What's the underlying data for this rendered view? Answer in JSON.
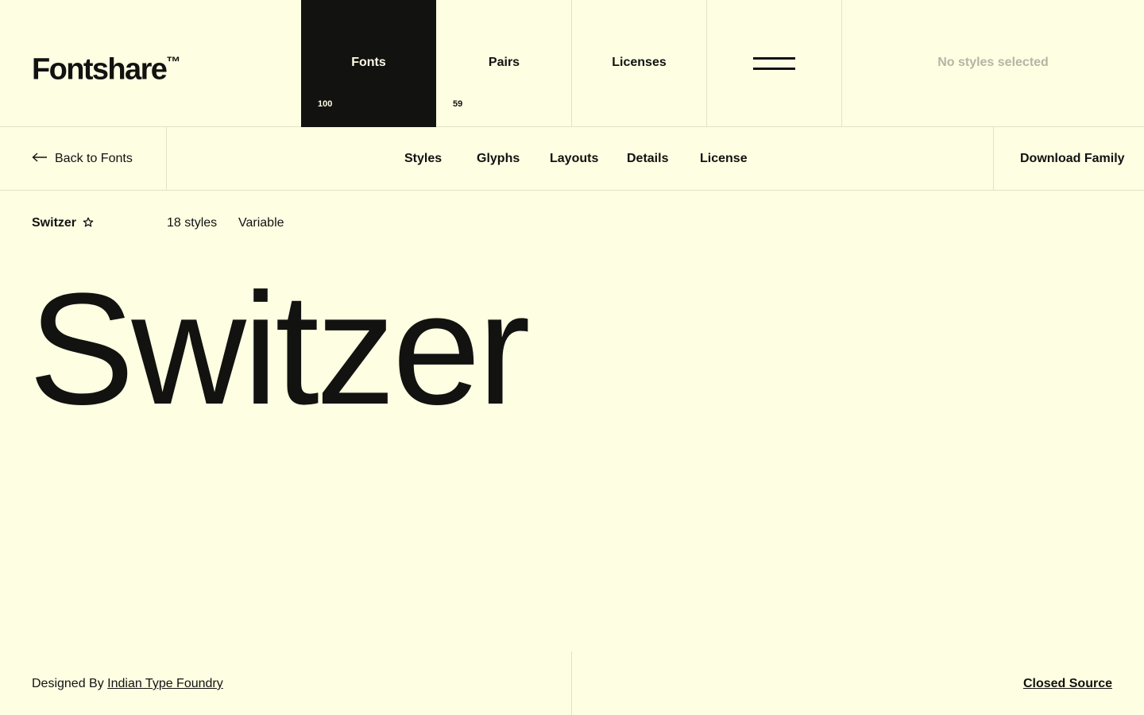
{
  "header": {
    "logo": "Fontshare",
    "logo_mark": "™",
    "nav": [
      {
        "label": "Fonts",
        "count": "100"
      },
      {
        "label": "Pairs",
        "count": "59"
      },
      {
        "label": "Licenses"
      }
    ],
    "menu_icon": "hamburger-icon",
    "styles_status": "No styles selected"
  },
  "subnav": {
    "back_label": "Back to Fonts",
    "back_icon": "arrow-left-icon",
    "tabs": [
      "Styles",
      "Glyphs",
      "Layouts",
      "Details",
      "License"
    ],
    "download_label": "Download Family"
  },
  "font": {
    "name": "Switzer",
    "favorite_icon": "star-outline-icon",
    "styles_count": "18 styles",
    "type": "Variable",
    "specimen_text": "Switzer"
  },
  "footer": {
    "designed_by_prefix": "Designed By",
    "designer": "Indian Type Foundry",
    "source": "Closed Source"
  },
  "colors": {
    "background": "#fefee3",
    "ink": "#121210",
    "muted": "#b5b5a3",
    "rule": "#e2e2c8"
  }
}
